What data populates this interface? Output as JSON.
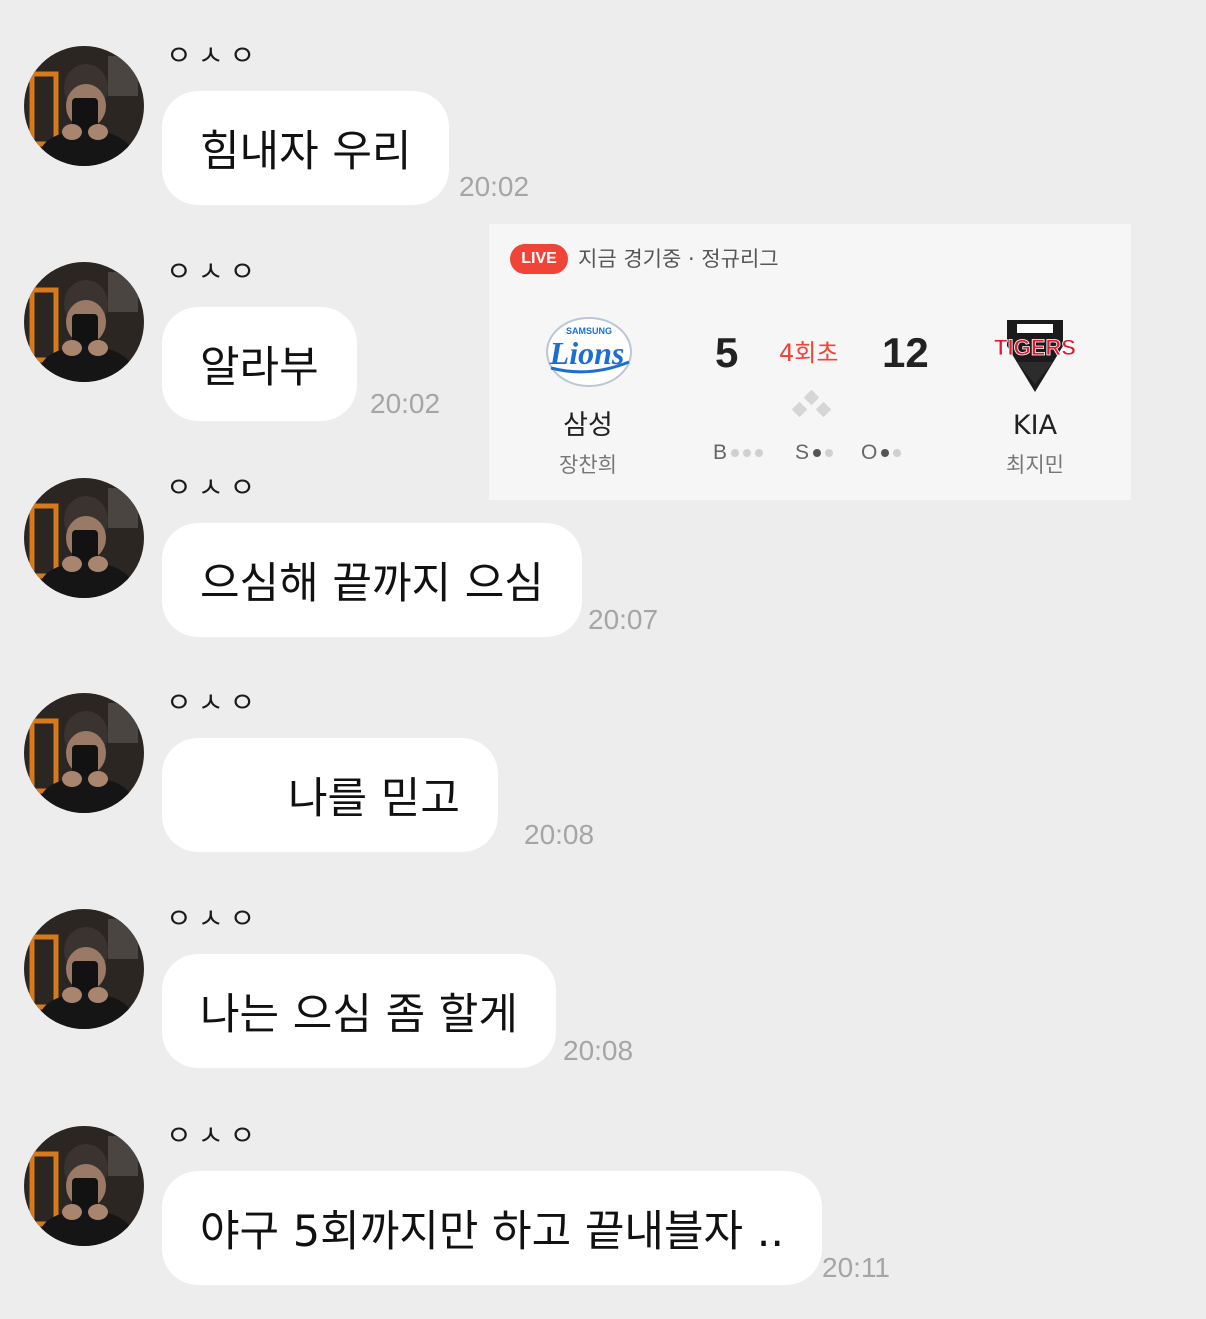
{
  "sender_name": "ㅇㅅㅇ",
  "messages": [
    {
      "text": "힘내자 우리",
      "time": "20:02"
    },
    {
      "text": "알라부",
      "time": "20:02"
    },
    {
      "text": "으심해 끝까지 으심",
      "time": "20:07"
    },
    {
      "text": "나를 믿고",
      "time": "20:08"
    },
    {
      "text": "나는 으심 좀 할게",
      "time": "20:08"
    },
    {
      "text": "야구 5회까지만 하고 끝내블자 ..",
      "time": "20:11"
    }
  ],
  "scoreboard": {
    "live_label": "LIVE",
    "status": "지금 경기중 · 정규리그",
    "inning": "4회초",
    "home": {
      "name": "삼성",
      "pitcher": "장찬희",
      "score": "5",
      "logo": "samsung-lions-logo",
      "logo_text": "Lions",
      "logo_top_text": "SAMSUNG",
      "logo_color": "#1d6fcf"
    },
    "away": {
      "name": "KIA",
      "pitcher": "최지민",
      "score": "12",
      "logo": "kia-tigers-logo",
      "logo_text": "TIGERS",
      "logo_color": "#e3182d"
    },
    "count": {
      "b_label": "B",
      "balls": 0,
      "s_label": "S",
      "strikes": 1,
      "o_label": "O",
      "outs": 1
    }
  },
  "colors": {
    "background": "#ededed",
    "bubble": "#ffffff",
    "time": "#a5a5a5",
    "live": "#f04438"
  }
}
